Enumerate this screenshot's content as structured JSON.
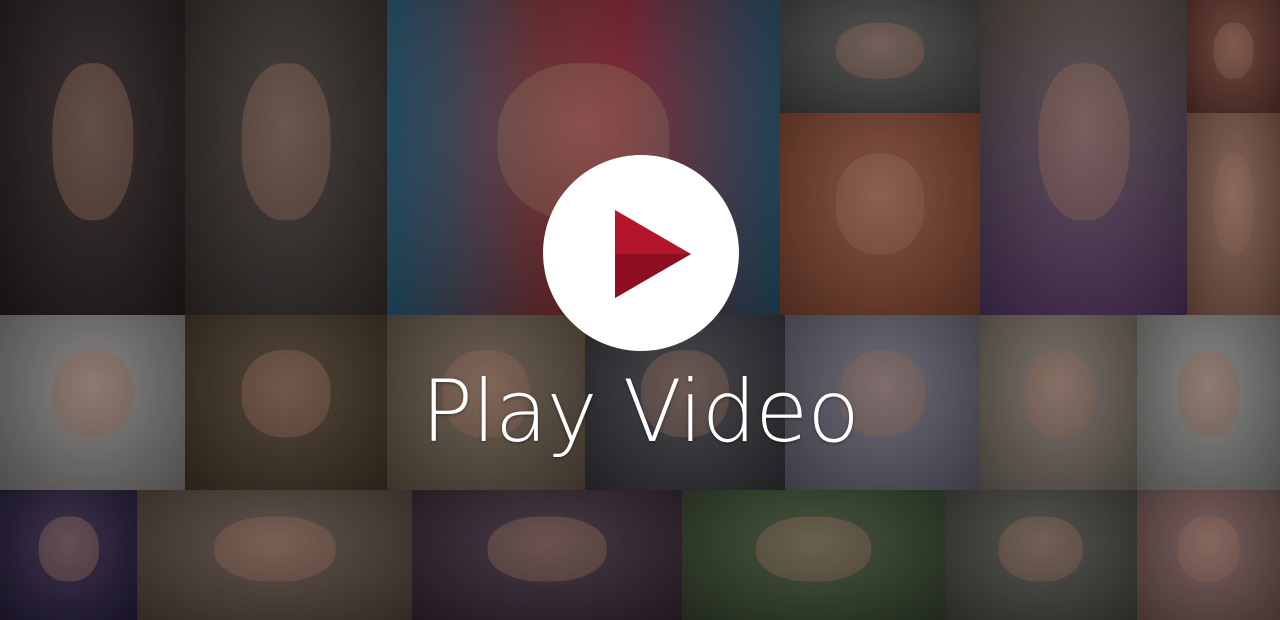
{
  "video": {
    "play_label": "Play Video",
    "accent_color": "#b3142c"
  }
}
